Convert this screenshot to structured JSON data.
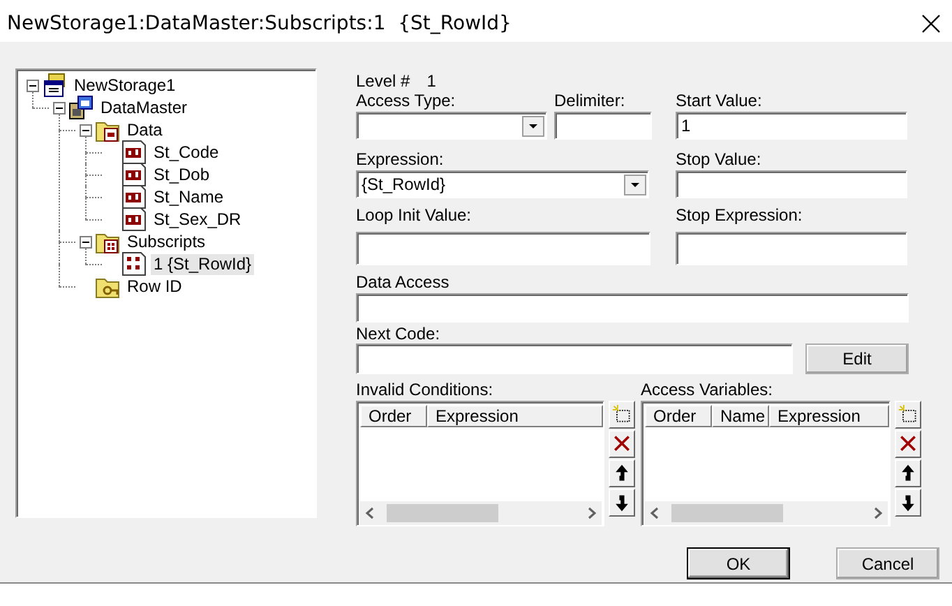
{
  "window": {
    "title": "NewStorage1:DataMaster:Subscripts:1  {St_RowId}"
  },
  "tree": [
    {
      "label": "NewStorage1",
      "kind": "storage",
      "expanded": true,
      "selected": false,
      "children": [
        {
          "label": "DataMaster",
          "kind": "master",
          "expanded": true,
          "selected": false,
          "children": [
            {
              "label": "Data",
              "kind": "data-folder",
              "expanded": true,
              "selected": false,
              "children": [
                {
                  "label": "St_Code",
                  "kind": "field",
                  "selected": false
                },
                {
                  "label": "St_Dob",
                  "kind": "field",
                  "selected": false
                },
                {
                  "label": "St_Name",
                  "kind": "field",
                  "selected": false
                },
                {
                  "label": "St_Sex_DR",
                  "kind": "field",
                  "selected": false
                }
              ]
            },
            {
              "label": "Subscripts",
              "kind": "subscript-folder",
              "expanded": true,
              "selected": false,
              "children": [
                {
                  "label": "1  {St_RowId}",
                  "kind": "subscript",
                  "selected": true
                }
              ]
            },
            {
              "label": "Row ID",
              "kind": "rowid-folder",
              "selected": false
            }
          ]
        }
      ]
    }
  ],
  "form": {
    "level": {
      "label": "Level #",
      "value": "1"
    },
    "access_type": {
      "label": "Access Type:"
    },
    "delimiter": {
      "label": "Delimiter:"
    },
    "start_value": {
      "label": "Start Value:",
      "value": "1"
    },
    "expression": {
      "label": "Expression:",
      "value": "{St_RowId}"
    },
    "stop_value": {
      "label": "Stop Value:"
    },
    "loop_init_value": {
      "label": "Loop Init Value:"
    },
    "stop_expression": {
      "label": "Stop Expression:"
    },
    "data_access": {
      "label": "Data Access"
    },
    "next_code": {
      "label": "Next Code:",
      "button": "Edit"
    }
  },
  "invalid_conditions": {
    "label": "Invalid Conditions:",
    "columns": [
      "Order",
      "Expression"
    ]
  },
  "access_variables": {
    "label": "Access Variables:",
    "columns": [
      "Order",
      "Name",
      "Expression"
    ]
  },
  "buttons": [
    {
      "label": "OK",
      "default": true
    },
    {
      "label": "Cancel",
      "default": false
    }
  ]
}
